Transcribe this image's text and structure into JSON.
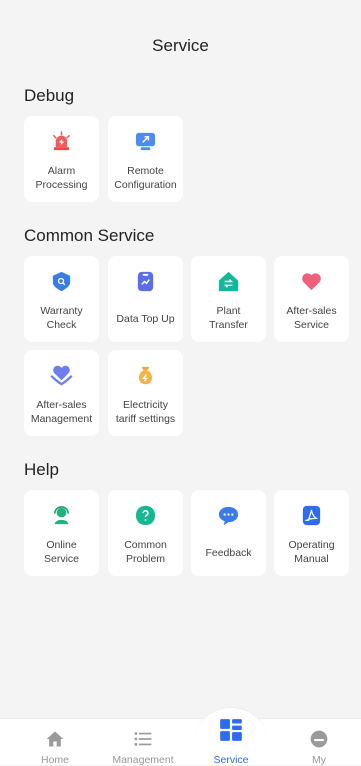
{
  "header": {
    "title": "Service"
  },
  "sections": {
    "debug": {
      "title": "Debug",
      "items": [
        {
          "label": "Alarm\nProcessing",
          "icon": "alarm-siren-icon"
        },
        {
          "label": "Remote\nConfiguration",
          "icon": "remote-monitor-icon"
        }
      ]
    },
    "common": {
      "title": "Common Service",
      "items": [
        {
          "label": "Warranty\nCheck",
          "icon": "shield-search-icon"
        },
        {
          "label": "Data Top Up",
          "icon": "data-card-icon"
        },
        {
          "label": "Plant\nTransfer",
          "icon": "house-transfer-icon"
        },
        {
          "label": "After-sales\nService",
          "icon": "heart-icon"
        },
        {
          "label": "After-sales\nManagement",
          "icon": "heart-hands-icon"
        },
        {
          "label": "Electricity\ntariff settings",
          "icon": "money-bag-icon"
        }
      ]
    },
    "help": {
      "title": "Help",
      "items": [
        {
          "label": "Online\nService",
          "icon": "headset-agent-icon"
        },
        {
          "label": "Common\nProblem",
          "icon": "question-icon"
        },
        {
          "label": "Feedback",
          "icon": "chat-bubble-icon"
        },
        {
          "label": "Operating\nManual",
          "icon": "pdf-document-icon"
        }
      ]
    }
  },
  "tabbar": {
    "items": [
      {
        "label": "Home",
        "icon": "home-icon"
      },
      {
        "label": "Management",
        "icon": "list-icon"
      },
      {
        "label": "Service",
        "icon": "service-grid-icon",
        "active": true
      },
      {
        "label": "My",
        "icon": "user-face-icon"
      }
    ]
  },
  "colors": {
    "accent": "#2d6cf0",
    "background": "#f4f4f4",
    "card": "#ffffff",
    "inactive_tab": "#999999"
  }
}
